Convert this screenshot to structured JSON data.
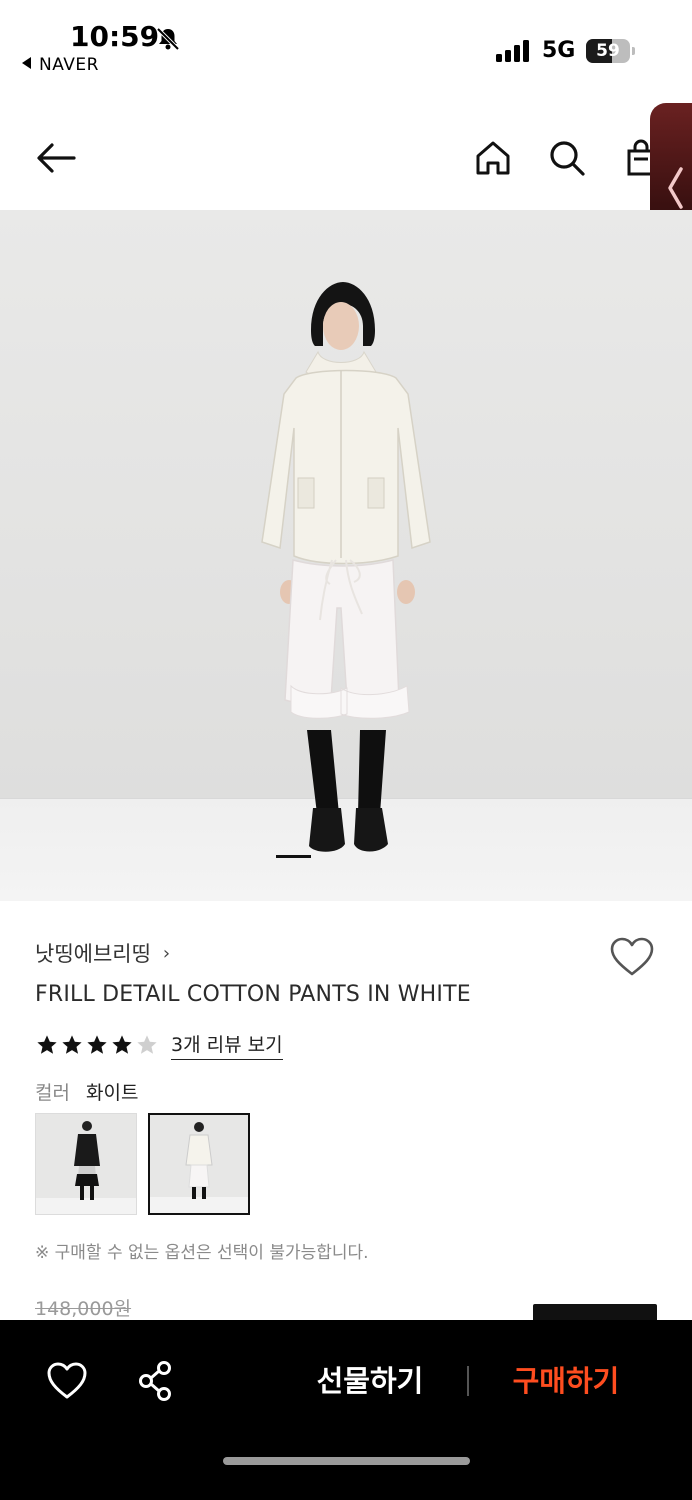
{
  "status_bar": {
    "time": "10:59",
    "back_app": "NAVER",
    "network": "5G",
    "battery": "59",
    "battery_level": 0.59
  },
  "nav": {
    "icons": [
      "back-arrow-icon",
      "home-icon",
      "search-icon",
      "shopping-bag-icon",
      "chevron-left-icon"
    ]
  },
  "gallery": {
    "current_index": 1
  },
  "product": {
    "brand": "낫띵에브리띵",
    "brand_chevron": "›",
    "title": "FRILL DETAIL COTTON PANTS IN WHITE",
    "rating": 4,
    "rating_max": 5,
    "review_link": "3개 리뷰 보기",
    "color_label": "컬러",
    "color_value": "화이트",
    "notice": "※ 구매할 수 없는 옵션은 선택이 불가능합니다.",
    "original_price": "148,000원"
  },
  "bottom_bar": {
    "gift_label": "선물하기",
    "buy_label": "구매하기"
  },
  "colors": {
    "buy_accent": "#ff4d1f",
    "bar_bg": "#000000",
    "star": "#111111",
    "star_empty": "#cfcfcf"
  }
}
